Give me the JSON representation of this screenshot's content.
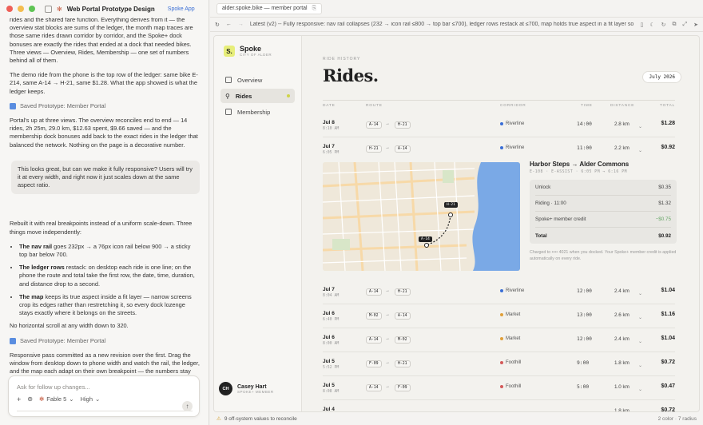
{
  "chat": {
    "title": "Web Portal Prototype Design",
    "project": "Spoke App",
    "para1": "rides and the shared fare function. Everything derives from it — the overview stat blocks are sums of the ledger, the month map traces are those same rides drawn corridor by corridor, and the Spoke+ dock bonuses are exactly the rides that ended at a dock that needed bikes. Three views — Overview, Rides, Membership — one set of numbers behind all of them.",
    "para2": "The demo ride from the phone is the top row of the ledger: same bike E-214, same A-14 → H-21, same $1.28. What the app showed is what the ledger keeps.",
    "saved1": "Saved Prototype: Member Portal",
    "para3": "Portal's up at three views. The overview reconciles end to end — 14 rides, 2h 25m, 29.0 km, $12.63 spent, $9.66 saved — and the membership dock bonuses add back to the exact rides in the ledger that balanced the network. Nothing on the page is a decorative number.",
    "user_msg": "This looks great, but can we make it fully responsive? Users will try it at every width, and right now it just scales down at the same aspect ratio.",
    "para4": "Rebuilt it with real breakpoints instead of a uniform scale-down. Three things move independently:",
    "b1_bold": "The nav rail",
    "b1": " goes 232px → a 76px icon rail below 900 → a sticky top bar below 700.",
    "b2_bold": "The ledger rows",
    "b2": " restack: on desktop each ride is one line; on the phone the route and total take the first row, the date, time, duration, and distance drop to a second.",
    "b3_bold": "The map",
    "b3": " keeps its true aspect inside a fit layer — narrow screens crop its edges rather than restretching it, so every dock lozenge stays exactly where it belongs on the streets.",
    "para5": "No horizontal scroll at any width down to 320.",
    "saved2": "Saved Prototype: Member Portal",
    "para6": "Responsive pass committed as a new revision over the first. Drag the window from desktop down to phone width and watch the rail, the ledger, and the map each adapt on their own breakpoint — the numbers stay reconciled the whole way down.",
    "composer_placeholder": "Ask for follow up changes...",
    "model": "Fable 5",
    "effort": "High"
  },
  "browser": {
    "tab_title": "alder.spoke.bike — member portal",
    "url": "Latest (v2) -- Fully responsive: nav rail collapses (232 → icon rail ≤800 → top bar ≤700), ledger rows restack at ≤700, map holds true aspect in a fit layer so dock ..."
  },
  "portal": {
    "brand": "Spoke",
    "brand_sub": "CITY OF ALDER",
    "nav": [
      {
        "label": "Overview"
      },
      {
        "label": "Rides"
      },
      {
        "label": "Membership"
      }
    ],
    "user_name": "Casey Hart",
    "user_role": "SPOKE+ MEMBER",
    "user_initials": "CH",
    "eyebrow": "RIDE HISTORY",
    "title": "Rides.",
    "month": "July 2026",
    "headers": {
      "date": "DATE",
      "route": "ROUTE",
      "corridor": "CORRIDOR",
      "time": "TIME",
      "distance": "DISTANCE",
      "total": "TOTAL"
    },
    "rows": [
      {
        "date": "Jul 8",
        "sub": "8:10 AM",
        "from": "A-14",
        "to": "H-21",
        "corridor": "Riverline",
        "color": "#3b6fd6",
        "time": "14:00",
        "dist": "2.8 km",
        "amt": "$1.28"
      },
      {
        "date": "Jul 7",
        "sub": "6:05 PM",
        "from": "H-21",
        "to": "A-14",
        "corridor": "Riverline",
        "color": "#3b6fd6",
        "time": "11:00",
        "dist": "2.2 km",
        "amt": "$0.92"
      },
      {
        "date": "Jul 7",
        "sub": "8:04 AM",
        "from": "A-14",
        "to": "H-21",
        "corridor": "Riverline",
        "color": "#3b6fd6",
        "time": "12:00",
        "dist": "2.4 km",
        "amt": "$1.04"
      },
      {
        "date": "Jul 6",
        "sub": "6:40 PM",
        "from": "M-02",
        "to": "A-14",
        "corridor": "Market",
        "color": "#e0a03a",
        "time": "13:00",
        "dist": "2.6 km",
        "amt": "$1.16"
      },
      {
        "date": "Jul 6",
        "sub": "8:00 AM",
        "from": "A-14",
        "to": "M-02",
        "corridor": "Market",
        "color": "#e0a03a",
        "time": "12:00",
        "dist": "2.4 km",
        "amt": "$1.04"
      },
      {
        "date": "Jul 5",
        "sub": "5:52 PM",
        "from": "F-09",
        "to": "H-21",
        "corridor": "Foothill",
        "color": "#d45a5a",
        "time": "9:00",
        "dist": "1.8 km",
        "amt": "$0.72"
      },
      {
        "date": "Jul 5",
        "sub": "8:08 AM",
        "from": "A-14",
        "to": "F-09",
        "corridor": "Foothill",
        "color": "#d45a5a",
        "time": "5:00",
        "dist": "1.0 km",
        "amt": "$0.47"
      },
      {
        "date": "Jul 4",
        "sub": "",
        "from": "",
        "to": "",
        "corridor": "",
        "color": "#d45a5a",
        "time": "",
        "dist": "1.8 km",
        "amt": "$0.72"
      }
    ],
    "detail": {
      "title": "Harbor Steps → Alder Commons",
      "sub": "E-108 · E-ASSIST · 6:05 PM → 6:16 PM",
      "lines": [
        {
          "label": "Unlock",
          "value": "$0.35"
        },
        {
          "label": "Riding · 11:00",
          "value": "$1.32"
        },
        {
          "label": "Spoke+ member credit",
          "value": "−$0.75"
        },
        {
          "label": "Total",
          "value": "$0.92"
        }
      ],
      "note": "Charged to •••• 4021 when you docked. Your Spoke+ member credit is applied automatically on every ride.",
      "map_pin_a": "A-14",
      "map_pin_h": "H-21"
    }
  },
  "status": {
    "warning": "9 off-system values to reconcile",
    "right": "2 color · 7 radius"
  }
}
